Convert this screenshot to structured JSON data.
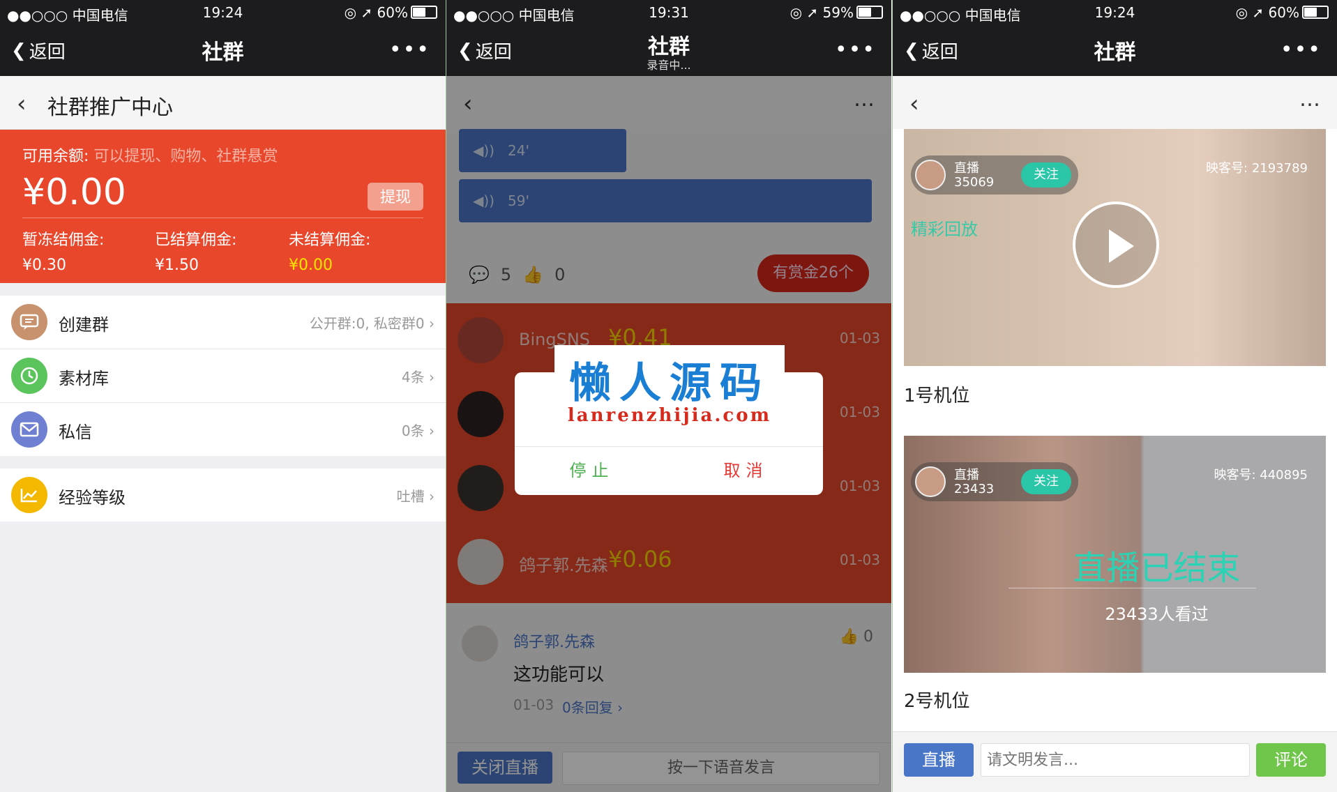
{
  "s1": {
    "status": {
      "carrier": "●●○○○ 中国电信",
      "time": "19:24",
      "battery": "60%",
      "battery_level": 0.6
    },
    "nav": {
      "back": "返回",
      "title": "社群"
    },
    "page_title": "社群推广中心",
    "balance": {
      "label": "可用余额:",
      "hint": "可以提现、购物、社群悬赏",
      "amount": "¥0.00",
      "withdraw": "提现",
      "frozen_label": "暂冻结佣金:",
      "frozen_value": "¥0.30",
      "settled_label": "已结算佣金:",
      "settled_value": "¥1.50",
      "unsettled_label": "未结算佣金:",
      "unsettled_value": "¥0.00"
    },
    "menu": [
      {
        "label": "创建群",
        "right": "公开群:0, 私密群0",
        "icon": "chat-icon",
        "color": "#c8926e"
      },
      {
        "label": "素材库",
        "right": "4条",
        "icon": "clock-icon",
        "color": "#5cc45c"
      },
      {
        "label": "私信",
        "right": "0条",
        "icon": "mail-icon",
        "color": "#6f7fd1"
      }
    ],
    "level": {
      "label": "经验等级",
      "right": "吐槽",
      "icon": "chart-icon",
      "color": "#f5b800"
    }
  },
  "s2": {
    "status": {
      "carrier": "●●○○○ 中国电信",
      "time": "19:31",
      "battery": "59%",
      "battery_level": 0.59
    },
    "nav": {
      "back": "返回",
      "title": "社群",
      "subtitle": "录音中..."
    },
    "voices": [
      "24'",
      "59'"
    ],
    "comments_count": "5",
    "likes_count": "0",
    "reward_button": "有赏金26个",
    "rewards": [
      {
        "name": "BingSNS",
        "amount": "¥0.41",
        "date": "01-03"
      },
      {
        "name": "",
        "amount": "",
        "date": "01-03"
      },
      {
        "name": "",
        "amount": "",
        "date": "01-03"
      },
      {
        "name": "鸽子郭.先森",
        "amount": "¥0.06",
        "date": "01-03"
      }
    ],
    "comment": {
      "name": "鸽子郭.先森",
      "likes": "0",
      "text": "这功能可以",
      "date": "01-03",
      "replies": "0条回复"
    },
    "bottom": {
      "close_live": "关闭直播",
      "voice_hint": "按一下语音发言"
    },
    "dialog": {
      "stop": "停止",
      "cancel": "取消"
    },
    "watermark": {
      "cn": "懒人源码",
      "en": "lanrenzhijia.com"
    }
  },
  "s3": {
    "status": {
      "carrier": "●●○○○ 中国电信",
      "time": "19:24",
      "battery": "60%",
      "battery_level": 0.6
    },
    "nav": {
      "back": "返回",
      "title": "社群"
    },
    "videos": [
      {
        "status": "直播",
        "id": "35069",
        "follow": "关注",
        "viewer_label": "映客号:",
        "viewer_id": "2193789",
        "replay": "精彩回放",
        "label": "1号机位"
      },
      {
        "status": "直播",
        "id": "23433",
        "follow": "关注",
        "viewer_label": "映客号:",
        "viewer_id": "440895",
        "ended": "直播已结束",
        "watched": "23433人看过",
        "label": "2号机位"
      }
    ],
    "bottom": {
      "live": "直播",
      "placeholder": "请文明发言...",
      "comment": "评论"
    }
  }
}
